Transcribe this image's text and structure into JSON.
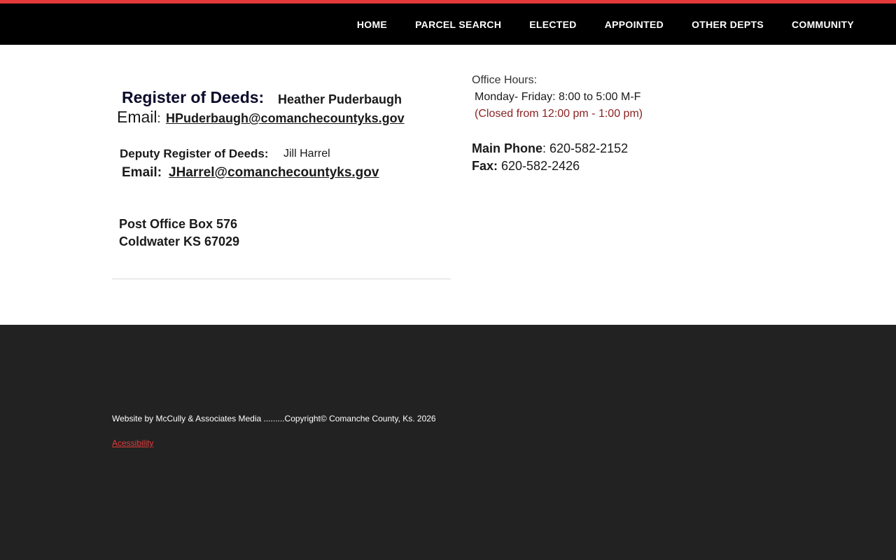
{
  "colors": {
    "accent": "#e53a3a",
    "nav_bg": "#000000",
    "footer_bg": "#222222",
    "closed_text": "#8b2222"
  },
  "nav": {
    "items": [
      "HOME",
      "PARCEL SEARCH",
      "ELECTED",
      "APPOINTED",
      "OTHER DEPTS",
      "COMMUNITY"
    ]
  },
  "register": {
    "title": "Register of Deeds:",
    "name": "Heather Puderbaugh",
    "email_label": "Email",
    "email_colon": ":",
    "email": "HPuderbaugh@comanchecountyks.gov"
  },
  "deputy": {
    "label": "Deputy Register of Deeds:",
    "name": "Jill Harrel",
    "email_label": "Email:",
    "email": "JHarrel@comanchecountyks.gov"
  },
  "address": {
    "line1": "Post Office Box 576",
    "line2": "Coldwater KS 67029"
  },
  "hours": {
    "label": "Office Hours:",
    "days": "Monday- Friday: 8:00 to 5:00 M-F",
    "closed": "(Closed from 12:00 pm - 1:00 pm)"
  },
  "contact": {
    "phone_label": "Main Phone",
    "phone_value": ": 620-582-2152",
    "fax_label": "Fax:",
    "fax_value": " 620-582-2426"
  },
  "footer": {
    "credit": "Website by McCully & Associates Media .........Copyright© Comanche County, Ks. 2026",
    "accessibility": "Acessibility"
  }
}
